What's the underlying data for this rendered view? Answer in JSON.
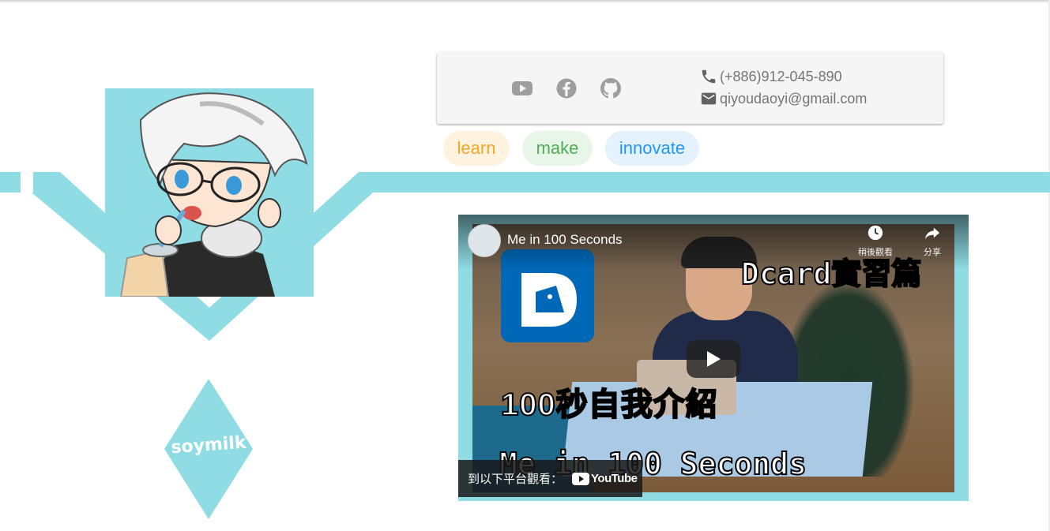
{
  "contact": {
    "phone": "(+886)912-045-890",
    "email": "qiyoudaoyi@gmail.com"
  },
  "social": [
    {
      "name": "youtube-icon"
    },
    {
      "name": "facebook-icon"
    },
    {
      "name": "github-icon"
    }
  ],
  "chips": {
    "learn": "learn",
    "make": "make",
    "innovate": "innovate"
  },
  "logo": {
    "text": "soymilk"
  },
  "video": {
    "title": "Me in 100 Seconds",
    "watch_later_label": "稍後觀看",
    "share_label": "分享",
    "watch_on_label": "到以下平台觀看：",
    "youtube_label": "YouTube",
    "thumbnail_badge": "Dcard實習篇",
    "thumbnail_caption_cn": "100秒自我介紹",
    "thumbnail_caption_en": "Me in 100 Seconds"
  },
  "colors": {
    "accent": "#8fdce5",
    "learn": "#f5a623",
    "make": "#4caf50",
    "innovate": "#2196f3",
    "icon_gray": "#757575"
  }
}
